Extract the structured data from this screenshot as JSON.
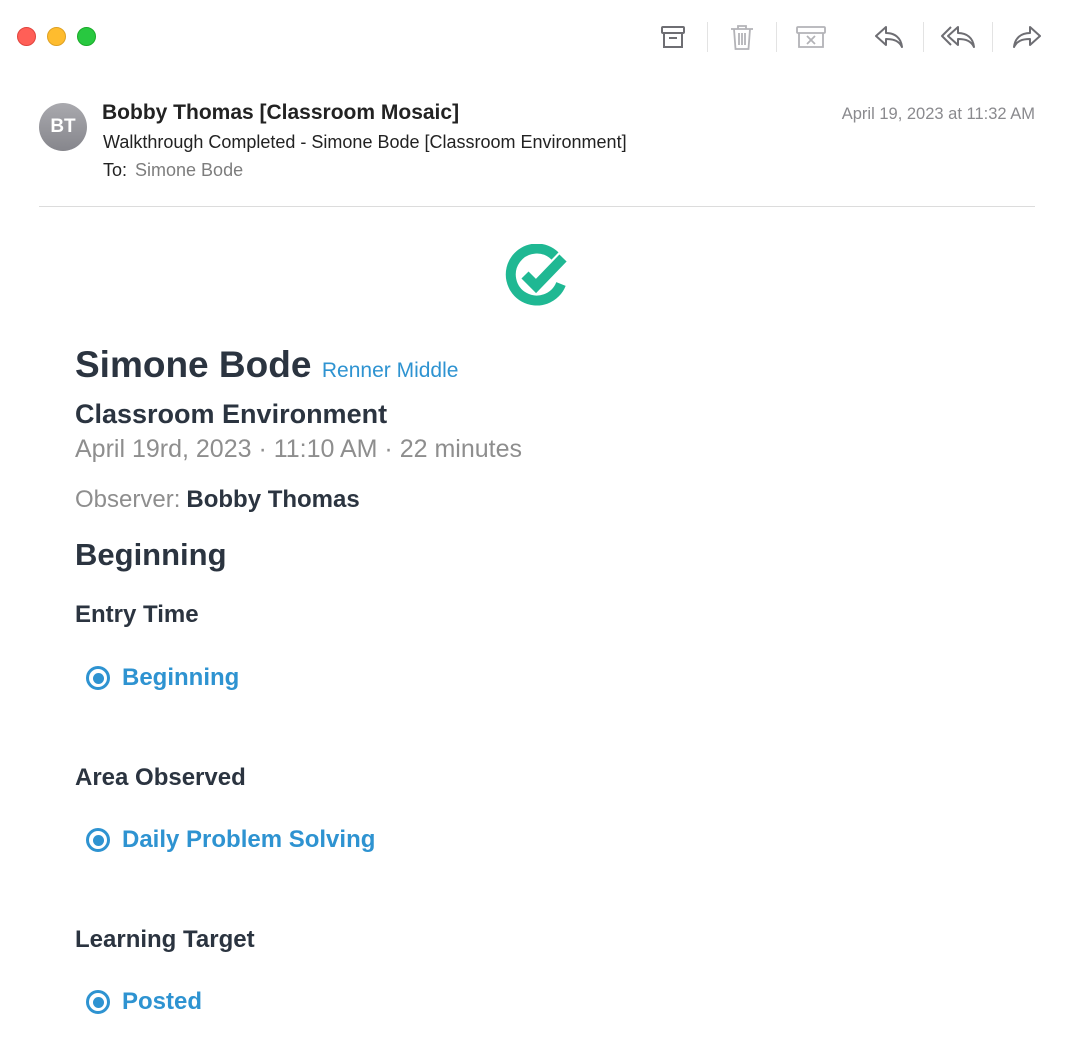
{
  "colors": {
    "accent": "#2e93d1",
    "heading": "#2b3440",
    "muted": "#8e8e8e",
    "logo": "#1fb893"
  },
  "toolbar": {
    "icons": [
      "archive-icon",
      "trash-icon",
      "junk-icon",
      "reply-icon",
      "reply-all-icon",
      "forward-icon"
    ]
  },
  "email": {
    "avatar_initials": "BT",
    "sender": "Bobby Thomas [Classroom Mosaic]",
    "subject": "Walkthrough Completed - Simone Bode [Classroom Environment]",
    "to_label": "To:",
    "to_value": "Simone Bode",
    "date": "April 19, 2023 at 11:32 AM"
  },
  "body": {
    "teacher": "Simone Bode",
    "school": "Renner Middle",
    "category": "Classroom Environment",
    "meta": "April 19rd, 2023 ·  11:10 AM  · 22 minutes",
    "observer_label": "Observer:",
    "observer_name": "Bobby Thomas",
    "section": "Beginning",
    "questions": [
      {
        "label": "Entry Time",
        "answer": "Beginning"
      },
      {
        "label": "Area Observed",
        "answer": "Daily Problem Solving"
      },
      {
        "label": "Learning Target",
        "answer": "Posted"
      }
    ]
  }
}
